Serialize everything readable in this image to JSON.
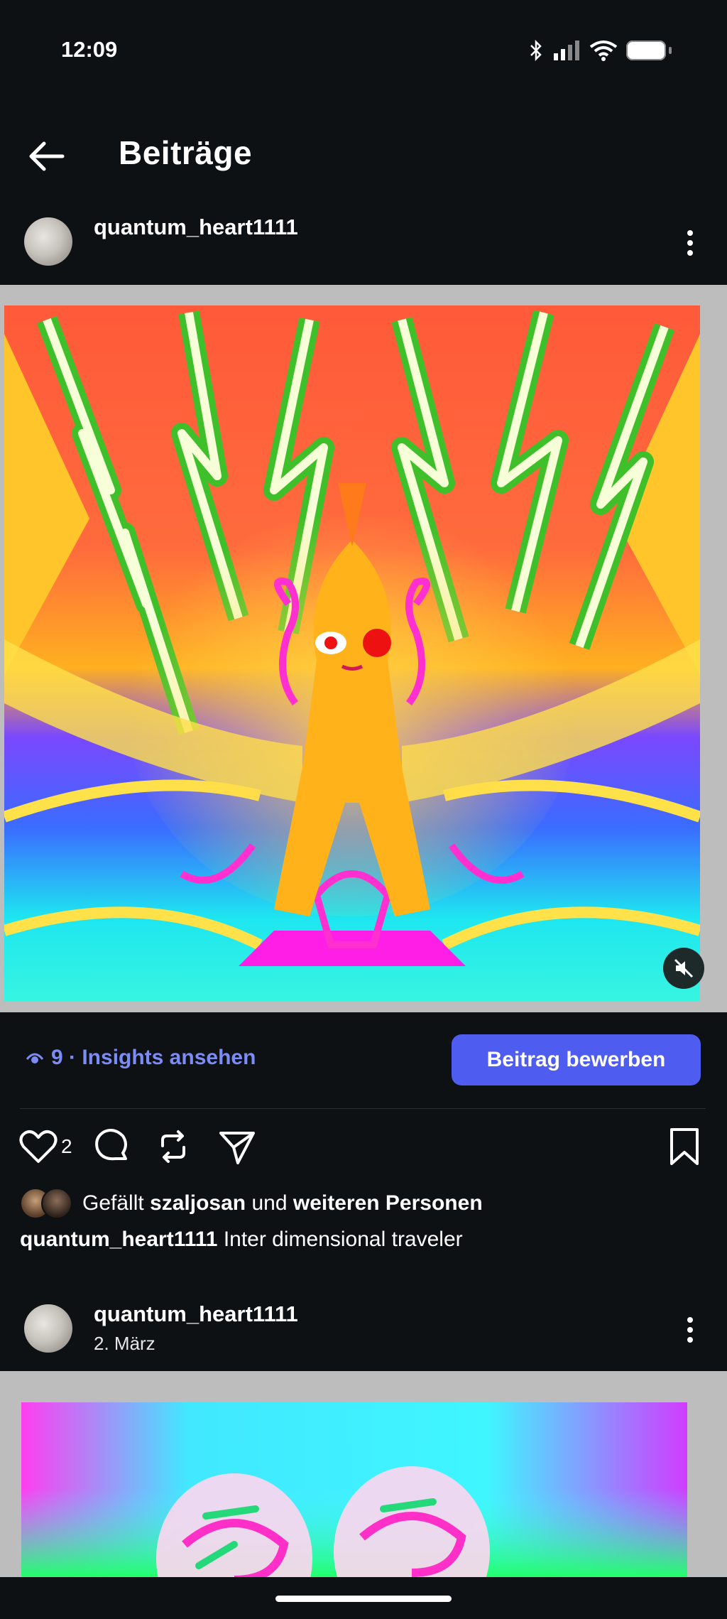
{
  "status_bar": {
    "time": "12:09",
    "icons": [
      "bluetooth-icon",
      "signal-icon",
      "wifi-icon",
      "battery-icon"
    ]
  },
  "header": {
    "title": "Beiträge",
    "back_icon": "arrow-left-icon"
  },
  "post1": {
    "username": "quantum_heart1111",
    "views": "9",
    "insights_text": "9 · Insights ansehen",
    "promote_label": "Beitrag bewerben",
    "like_count": "2",
    "liked_by_prefix": "Gefällt",
    "liked_by_user": "szaljosan",
    "liked_by_middle": "und",
    "liked_by_suffix": "weiteren Personen",
    "caption_user": "quantum_heart1111",
    "caption_text": "Inter dimensional traveler"
  },
  "post2": {
    "username": "quantum_heart1111",
    "date": "2. März"
  },
  "colors": {
    "background": "#0d1114",
    "accent": "#4f5cf0",
    "insights": "#7b8cf7"
  }
}
